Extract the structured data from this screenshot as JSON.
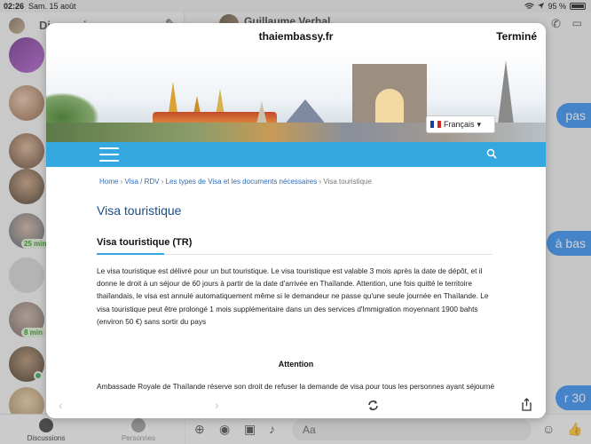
{
  "statusbar": {
    "time": "02:26",
    "date": "Sam. 15 août",
    "battery": "95 %"
  },
  "messenger": {
    "sidebar_title": "Discussions",
    "badges": [
      "25 min",
      "8 min"
    ],
    "tabs": [
      {
        "label": "Discussions"
      },
      {
        "label": "Personnes"
      }
    ],
    "chat_name": "Guillaume Verhal",
    "bubbles": [
      "pas",
      "à bas",
      "r 30"
    ],
    "input_placeholder": "Aa"
  },
  "modal": {
    "url": "thaiembassy.fr",
    "done_label": "Terminé",
    "language_label": "Français",
    "breadcrumb": {
      "home": "Home",
      "visa": "Visa / RDV",
      "types": "Les types de Visa et les documents nécessaires",
      "current": "Visa touristique",
      "sep": "›"
    },
    "page_title": "Visa touristique",
    "section_title": "Visa touristique (TR)",
    "paragraph": "Le visa touristique est délivré pour un but touristique. Le visa touristique est valable 3 mois après la date de dépôt, et il donne le droit à un séjour de 60 jours à partir de la date d'arrivée en Thaïlande. Attention, une fois quitté le territoire thaïlandais, le visa est annulé automatiquement même si le demandeur ne passe qu'une seule journée en Thaïlande. Le visa touristique peut être prolongé 1 mois supplémentaire dans un des services d'Immigration moyennant 1900 bahts (environ 50 €) sans sortir du pays",
    "attention_title": "Attention",
    "paragraph2": "Ambassade Royale de Thaïlande réserve son droit de refuser la demande de visa pour tous les personnes ayant séjourné plus que 90 jours depuis les derniers 6 mois qui précèdent la date du dépôt de dossier."
  },
  "colors": {
    "nav_blue": "#35a8e0",
    "title_blue": "#1b4d89",
    "link_blue": "#2e6bb5",
    "bubble_blue": "#2a8af5"
  }
}
